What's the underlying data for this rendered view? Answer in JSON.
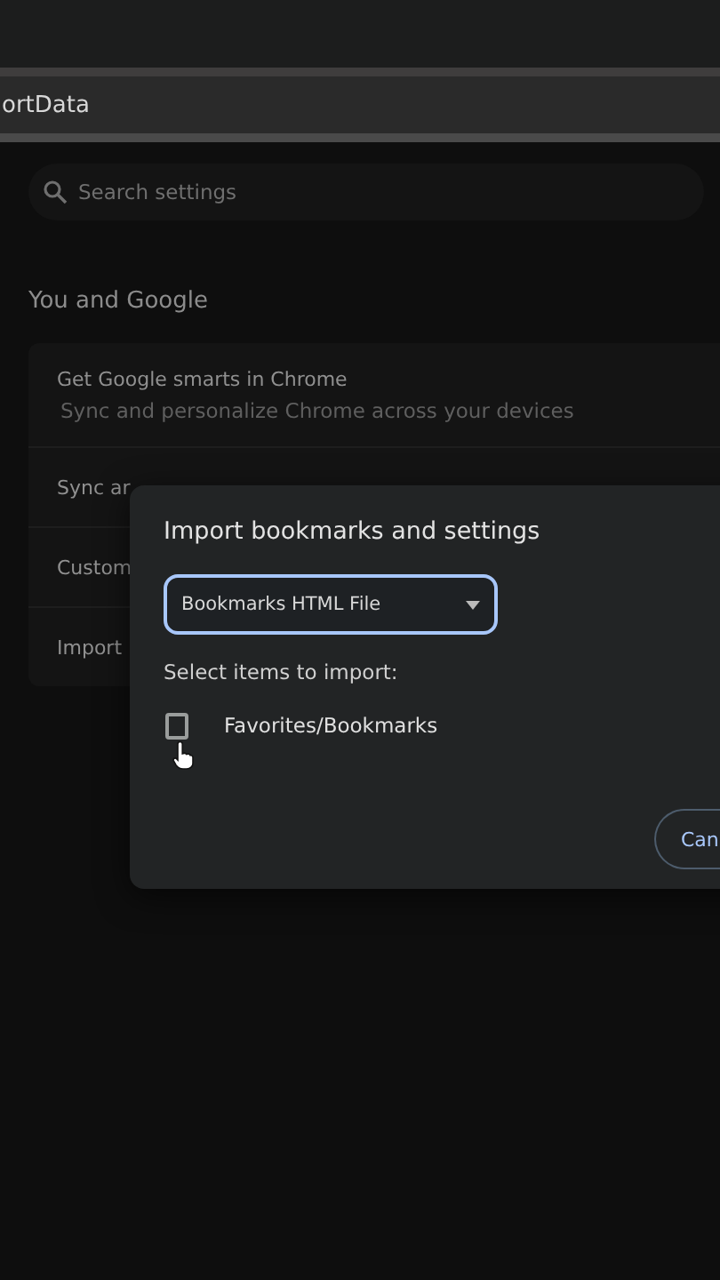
{
  "address_bar": {
    "url": "ortData"
  },
  "search": {
    "placeholder": "Search settings"
  },
  "section": {
    "title": "You and Google",
    "rows": [
      {
        "title": "Get Google smarts in Chrome",
        "subtitle": "Sync and personalize Chrome across your devices"
      },
      {
        "title": "Sync ar"
      },
      {
        "title": "Custom"
      },
      {
        "title": "Import"
      }
    ]
  },
  "dialog": {
    "title": "Import bookmarks and settings",
    "source": "Bookmarks HTML File",
    "prompt": "Select items to import:",
    "items": [
      {
        "label": "Favorites/Bookmarks",
        "checked": false
      }
    ],
    "buttons": [
      "Can"
    ]
  }
}
